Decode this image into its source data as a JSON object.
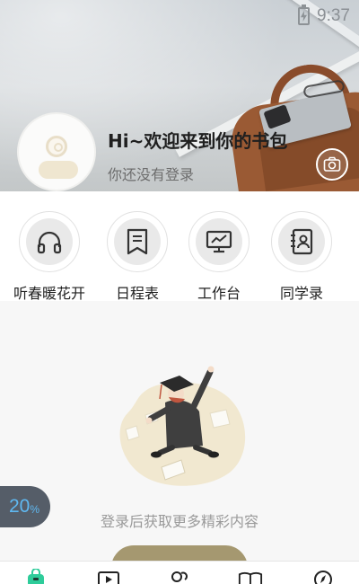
{
  "status_bar": {
    "time": "9:37",
    "battery_icon": "battery-charging-icon"
  },
  "profile": {
    "greeting": "Hi~欢迎来到你的书包",
    "login_hint": "你还没有登录",
    "avatar_icon": "default-avatar-icon",
    "camera_icon": "camera-icon"
  },
  "quick_actions": [
    {
      "label": "听春暖花开",
      "icon": "headphones-icon"
    },
    {
      "label": "日程表",
      "icon": "bookmark-list-icon"
    },
    {
      "label": "工作台",
      "icon": "monitor-chart-icon"
    },
    {
      "label": "同学录",
      "icon": "contact-book-icon"
    }
  ],
  "empty_state": {
    "message": "登录后获取更多精彩内容",
    "illustration": "graduate-jumping-illustration"
  },
  "progress_badge": {
    "value": "20",
    "unit": "%"
  },
  "tab_bar": {
    "tabs": [
      {
        "icon": "home-bag-icon",
        "active": true
      },
      {
        "icon": "play-video-icon",
        "active": false
      },
      {
        "icon": "friends-icon",
        "active": false
      },
      {
        "icon": "book-open-icon",
        "active": false
      },
      {
        "icon": "compass-icon",
        "active": false
      }
    ]
  },
  "colors": {
    "accent_gold": "#a59870",
    "badge_bg": "#555d68",
    "badge_text": "#5fb8f0",
    "active_tab": "#2ecc9a"
  }
}
